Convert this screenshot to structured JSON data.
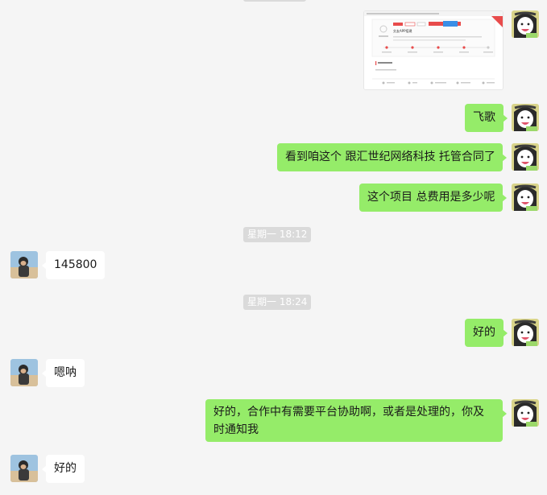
{
  "chat": {
    "msg_fei_ge": "飞歌",
    "msg_contract": "看到咱这个 跟汇世纪网络科技 托管合同了",
    "msg_total_cost": "这个项目 总费用是多少呢",
    "time_1": "星期一 18:12",
    "msg_amount": "145800",
    "time_2": "星期一 18:24",
    "msg_ok_1": "好的",
    "msg_en_na": "嗯呐",
    "msg_cooperation": "好的，合作中有需要平台协助啊，或者是处理的，你及时通知我",
    "msg_ok_2": "好的"
  },
  "screenshot_thumbnail": {
    "project_name": "交友APP搭建"
  },
  "colors": {
    "background": "#f5f5f5",
    "outgoing_bubble": "#95ec69",
    "incoming_bubble": "#ffffff",
    "timestamp_bg": "#dadada",
    "accent_red": "#e84b4b"
  }
}
